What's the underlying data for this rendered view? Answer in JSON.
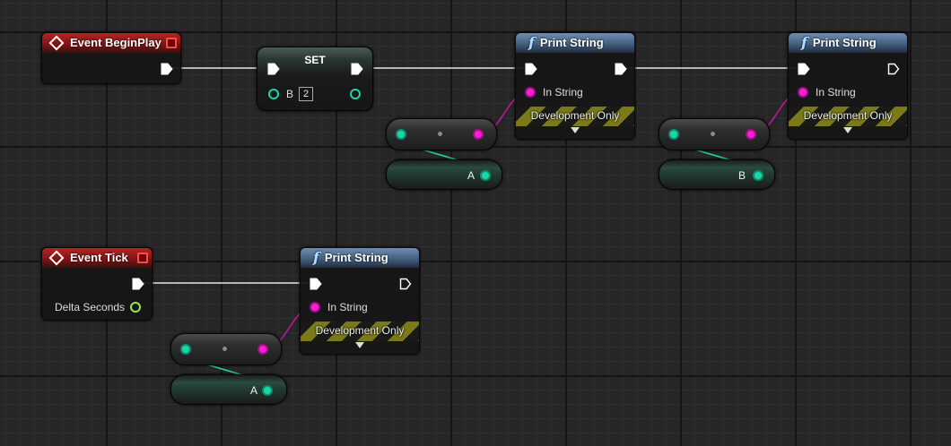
{
  "nodes": {
    "event_beginplay": {
      "title": "Event BeginPlay"
    },
    "event_tick": {
      "title": "Event Tick",
      "delta_label": "Delta Seconds"
    },
    "set": {
      "title": "SET",
      "var_label": "B",
      "value": "2"
    },
    "print_string_1": {
      "title": "Print String",
      "in_label": "In String",
      "dev_label": "Development Only"
    },
    "print_string_2": {
      "title": "Print String",
      "in_label": "In String",
      "dev_label": "Development Only"
    },
    "print_string_3": {
      "title": "Print String",
      "in_label": "In String",
      "dev_label": "Development Only"
    },
    "get_a_1": {
      "label": "A"
    },
    "get_b": {
      "label": "B"
    },
    "get_a_2": {
      "label": "A"
    }
  },
  "icons": {
    "event": "diamond-icon",
    "function": "function-icon",
    "delegate": "delegate-pin-icon",
    "exec": "exec-arrow-icon",
    "expand": "chevron-down-icon"
  },
  "colors": {
    "event_header": "#b32626",
    "function_header": "#3f5a7a",
    "exec_wire": "#e6e6e6",
    "string_pin": "#ff1fd2",
    "object_pin": "#1bd6a8",
    "float_pin": "#9be34d"
  }
}
